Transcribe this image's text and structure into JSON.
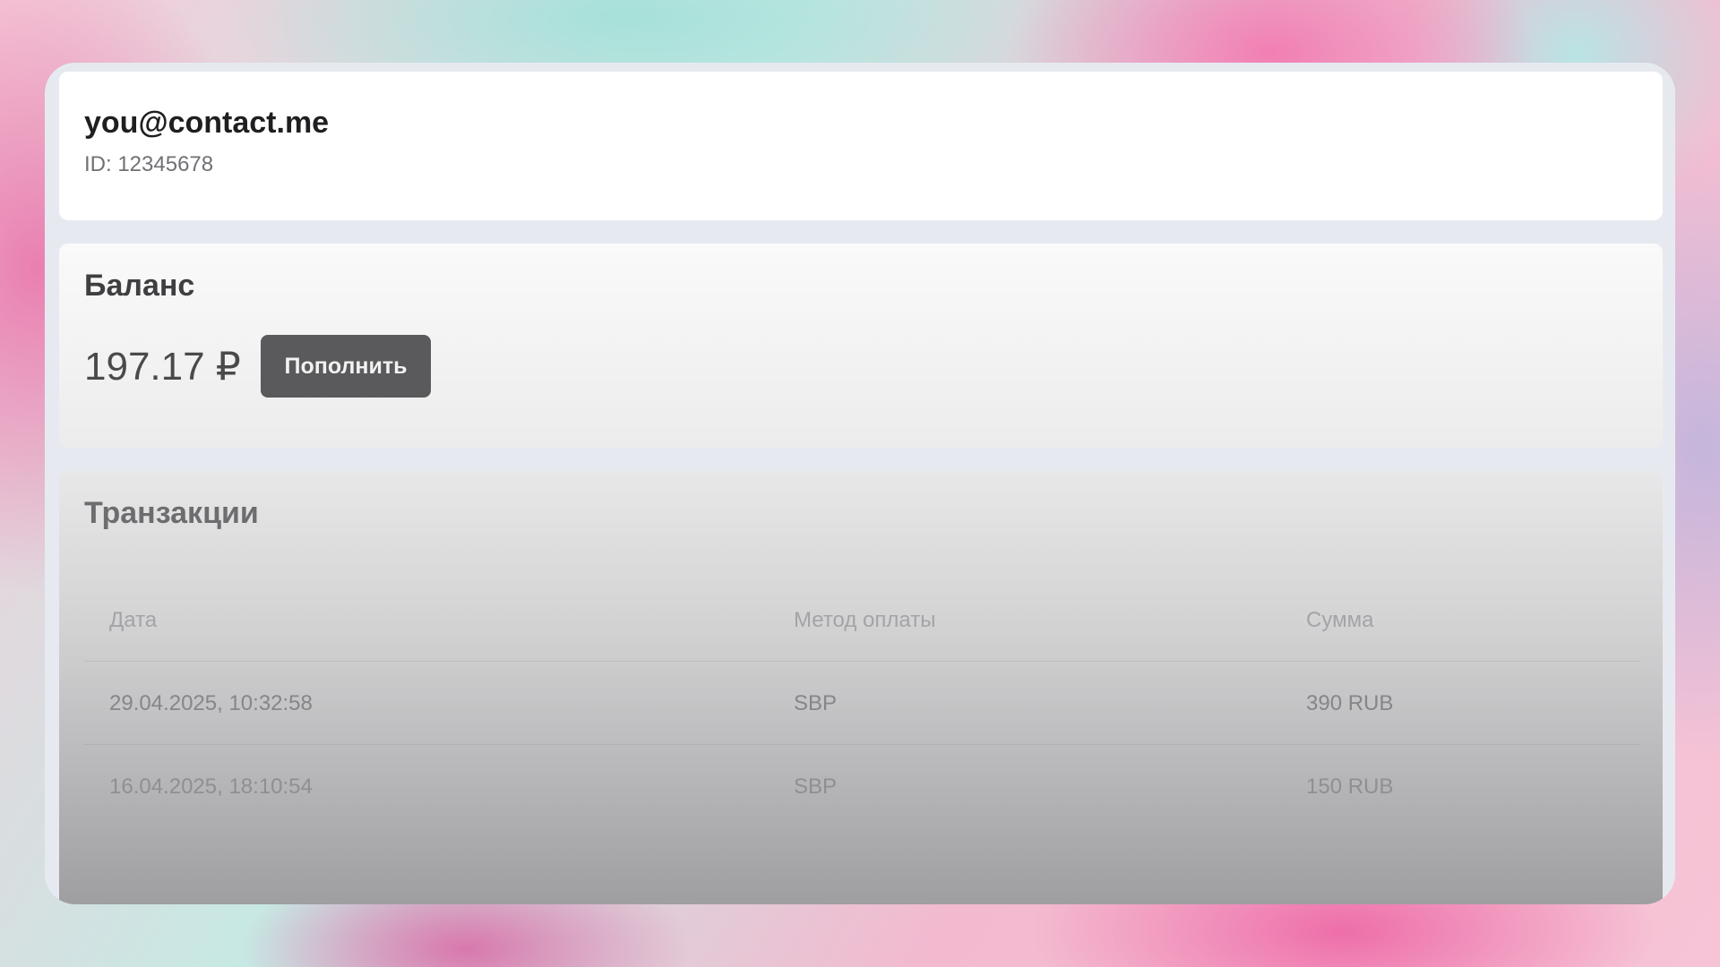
{
  "user": {
    "email": "you@contact.me",
    "id_text": "ID: 12345678"
  },
  "balance": {
    "title": "Баланс",
    "amount": "197.17 ₽",
    "topup_label": "Пополнить"
  },
  "transactions": {
    "title": "Транзакции",
    "columns": {
      "date": "Дата",
      "method": "Метод оплаты",
      "sum": "Сумма"
    },
    "rows": [
      {
        "date": "29.04.2025, 10:32:58",
        "method": "SBP",
        "sum": "390 RUB"
      },
      {
        "date": "16.04.2025, 18:10:54",
        "method": "SBP",
        "sum": "150 RUB"
      }
    ]
  },
  "colors": {
    "button_bg": "#5a5a5c",
    "panel_bg": "#e6eaf0"
  }
}
